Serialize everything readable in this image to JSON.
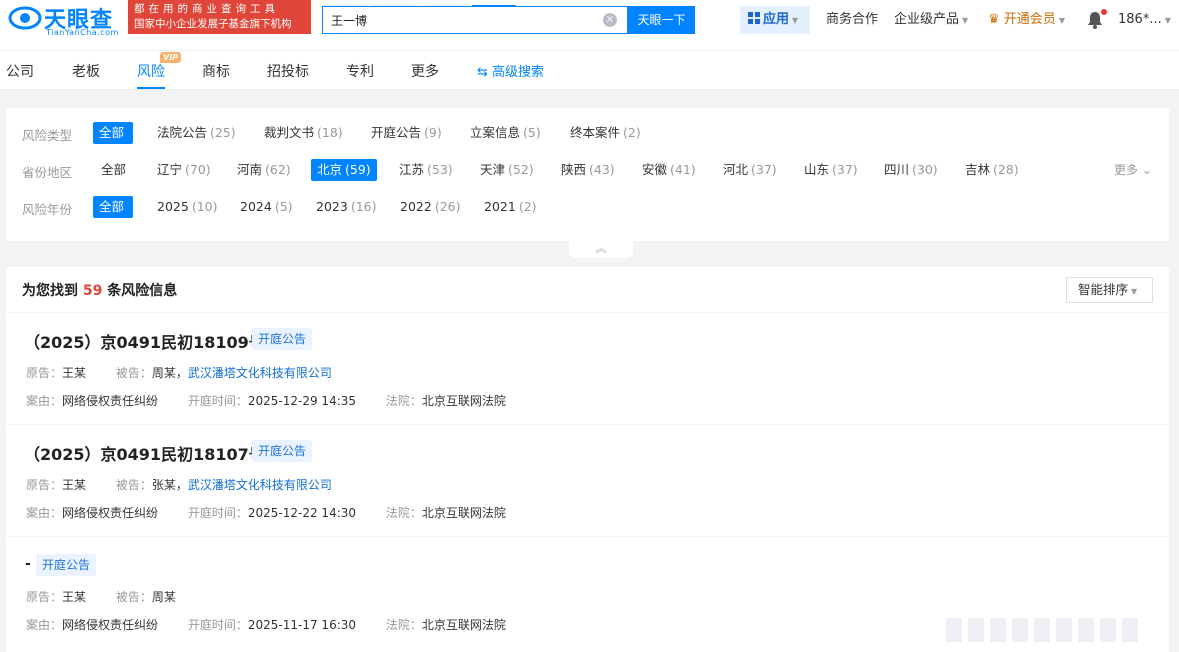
{
  "header": {
    "logo_text": "天眼查",
    "logo_sub": "TianYanCha.com",
    "promo_line1": "都在用的商业查询工具",
    "promo_line2": "国家中小企业发展子基金旗下机构",
    "search_value": "王一博",
    "search_button": "天眼一下",
    "apps_label": "应用",
    "links": [
      "商务合作",
      "企业级产品",
      "开通会员"
    ],
    "user": "186*..."
  },
  "nav": {
    "tabs": [
      "公司",
      "老板",
      "风险",
      "商标",
      "招投标",
      "专利",
      "更多"
    ],
    "active": "风险",
    "vip_tag": "VIP",
    "advanced_search": "高级搜索"
  },
  "filters": {
    "risk_type": {
      "label": "风险类型",
      "options": [
        {
          "name": "全部",
          "count": ""
        },
        {
          "name": "法院公告",
          "count": "(25)"
        },
        {
          "name": "裁判文书",
          "count": "(18)"
        },
        {
          "name": "开庭公告",
          "count": "(9)"
        },
        {
          "name": "立案信息",
          "count": "(5)"
        },
        {
          "name": "终本案件",
          "count": "(2)"
        }
      ]
    },
    "region": {
      "label": "省份地区",
      "options": [
        {
          "name": "全部",
          "count": ""
        },
        {
          "name": "辽宁",
          "count": "(70)"
        },
        {
          "name": "河南",
          "count": "(62)"
        },
        {
          "name": "北京",
          "count": "(59)"
        },
        {
          "name": "江苏",
          "count": "(53)"
        },
        {
          "name": "天津",
          "count": "(52)"
        },
        {
          "name": "陕西",
          "count": "(43)"
        },
        {
          "name": "安徽",
          "count": "(41)"
        },
        {
          "name": "河北",
          "count": "(37)"
        },
        {
          "name": "山东",
          "count": "(37)"
        },
        {
          "name": "四川",
          "count": "(30)"
        },
        {
          "name": "吉林",
          "count": "(28)"
        }
      ],
      "more": "更多"
    },
    "year": {
      "label": "风险年份",
      "options": [
        {
          "name": "全部",
          "count": ""
        },
        {
          "name": "2025",
          "count": "(10)"
        },
        {
          "name": "2024",
          "count": "(5)"
        },
        {
          "name": "2023",
          "count": "(16)"
        },
        {
          "name": "2022",
          "count": "(26)"
        },
        {
          "name": "2021",
          "count": "(2)"
        }
      ]
    }
  },
  "results": {
    "prefix": "为您找到",
    "count": "59",
    "suffix": "条风险信息",
    "sort_label": "智能排序",
    "items": [
      {
        "title": "（2025）京0491民初18109号",
        "badge": "开庭公告",
        "plaintiff_label": "原告：",
        "plaintiff": "王某",
        "defendant_label": "被告：",
        "defendant": "周某，",
        "defendant_company": "武汉潘塔文化科技有限公司",
        "cause_label": "案由：",
        "cause": "网络侵权责任纠纷",
        "time_label": "开庭时间：",
        "time": "2025-12-29 14:35",
        "court_label": "法院：",
        "court": "北京互联网法院"
      },
      {
        "title": "（2025）京0491民初18107号",
        "badge": "开庭公告",
        "plaintiff_label": "原告：",
        "plaintiff": "王某",
        "defendant_label": "被告：",
        "defendant": "张某，",
        "defendant_company": "武汉潘塔文化科技有限公司",
        "cause_label": "案由：",
        "cause": "网络侵权责任纠纷",
        "time_label": "开庭时间：",
        "time": "2025-12-22 14:30",
        "court_label": "法院：",
        "court": "北京互联网法院"
      },
      {
        "title": "-",
        "badge": "开庭公告",
        "plaintiff_label": "原告：",
        "plaintiff": "王某",
        "defendant_label": "被告：",
        "defendant": "周某",
        "defendant_company": "",
        "cause_label": "案由：",
        "cause": "网络侵权责任纠纷",
        "time_label": "开庭时间：",
        "time": "2025-11-17 16:30",
        "court_label": "法院：",
        "court": "北京互联网法院"
      }
    ]
  },
  "colors": {
    "brand": "#0084ff",
    "promo": "#e0453a",
    "vip": "#c96b00",
    "highlight_count": "#e0453a"
  }
}
